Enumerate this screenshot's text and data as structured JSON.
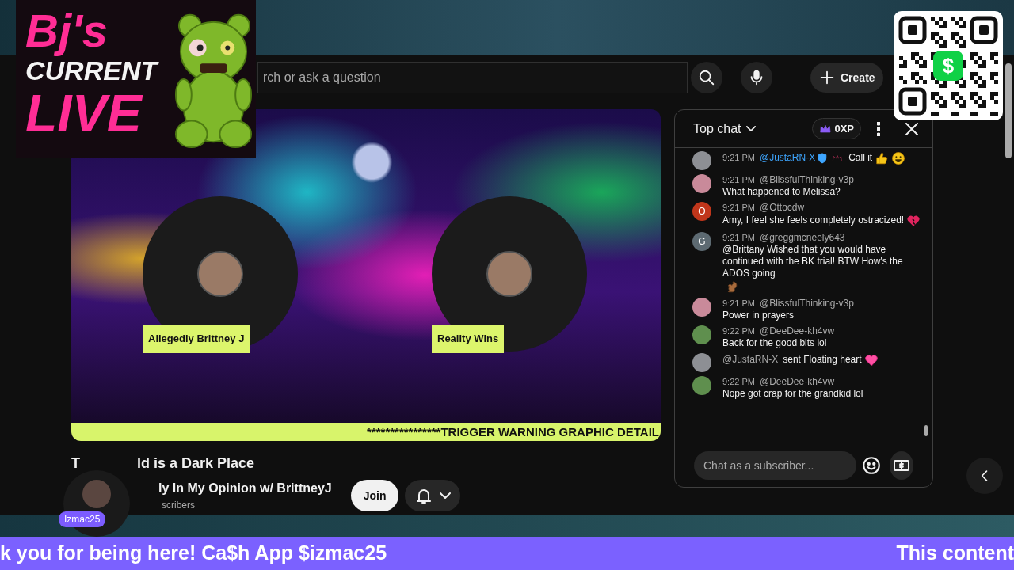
{
  "overlay_logo": {
    "line_1": "Bj's",
    "line_2": "CURRENT",
    "line_3": "LIVE"
  },
  "qr_code": {
    "badge": "$"
  },
  "header": {
    "search": {
      "placeholder": "rch or ask a question"
    },
    "create_button": "Create"
  },
  "video": {
    "participants": [
      {
        "name": "Allegedly Brittney J"
      },
      {
        "name": "Reality Wins"
      }
    ],
    "ticker": "****************TRIGGER WARNING GRAPHIC DETAIL"
  },
  "video_info": {
    "title_start": "T",
    "title_end": "ld is a Dark Place",
    "channel_name": "ly In My Opinion w/ BrittneyJ",
    "subscribers": "scribers",
    "join_button": "Join"
  },
  "host_overlay": {
    "name": "Izmac25"
  },
  "chat": {
    "mode": "Top chat",
    "xp": "0XP",
    "messages": [
      {
        "kind": "message",
        "avatar": {
          "kind": "photo",
          "color": "#8d8f94"
        },
        "time": "9:21 PM",
        "author": "@JustaRN-X",
        "verified": true,
        "text": "Call it"
      },
      {
        "kind": "message",
        "avatar": {
          "kind": "photo",
          "color": "#c98a9a"
        },
        "time": "9:21 PM",
        "author": "@BlissfulThinking-v3p",
        "verified": false,
        "text": "What happened to Melissa?"
      },
      {
        "kind": "message",
        "avatar": {
          "kind": "letter",
          "letter": "O",
          "color": "#c0361b"
        },
        "time": "9:21 PM",
        "author": "@Ottocdw",
        "verified": false,
        "text": "Amy, I feel she feels completely ostracized!"
      },
      {
        "kind": "message",
        "avatar": {
          "kind": "letter",
          "letter": "G",
          "color": "#5d6a72"
        },
        "time": "9:21 PM",
        "author": "@greggmcneely643",
        "verified": false,
        "text": "@Brittany Wished that you would have continued with the BK trial! BTW How's the ADOS going"
      },
      {
        "kind": "message",
        "avatar": {
          "kind": "photo",
          "color": "#c98a9a"
        },
        "time": "9:21 PM",
        "author": "@BlissfulThinking-v3p",
        "verified": false,
        "text": "Power in prayers"
      },
      {
        "kind": "message",
        "avatar": {
          "kind": "photo",
          "color": "#5f8f4e"
        },
        "time": "9:22 PM",
        "author": "@DeeDee-kh4vw",
        "verified": false,
        "text": "Back for the good bits lol"
      },
      {
        "kind": "gift",
        "avatar": {
          "kind": "photo",
          "color": "#8d8f94"
        },
        "author": "@JustaRN-X",
        "verified": false,
        "text": "sent Floating heart"
      },
      {
        "kind": "message",
        "avatar": {
          "kind": "photo",
          "color": "#5f8f4e"
        },
        "time": "9:22 PM",
        "author": "@DeeDee-kh4vw",
        "verified": false,
        "text": "Nope got crap for the grandkid lol"
      }
    ],
    "input": {
      "placeholder": "Chat as a subscriber..."
    }
  },
  "banner": {
    "left": "k you for being here! Ca$h App $izmac25",
    "right": "This content"
  }
}
